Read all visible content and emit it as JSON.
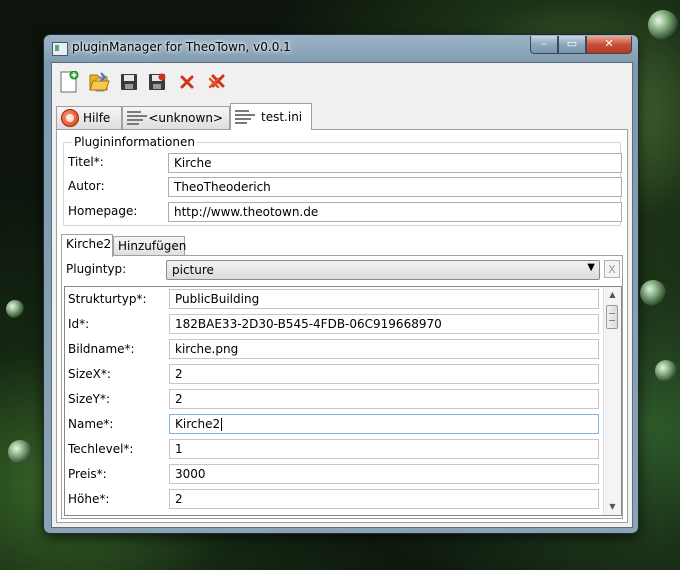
{
  "window": {
    "title": "pluginManager for TheoTown, v0.0.1",
    "min_glyph": "–",
    "max_glyph": "▭",
    "close_glyph": "✕"
  },
  "toolbar": {
    "icons": [
      "new-file-icon",
      "open-folder-icon",
      "save-icon",
      "save-as-icon",
      "delete-icon",
      "delete-all-icon"
    ]
  },
  "file_tabs": [
    {
      "label": "Hilfe",
      "icon": "help-icon"
    },
    {
      "label": "<unknown>",
      "icon": "document-icon"
    },
    {
      "label": "test.ini",
      "icon": "document-icon",
      "active": true
    }
  ],
  "plugin_info": {
    "group_title": "Plugininformationen",
    "fields": [
      {
        "label": "Titel*:",
        "value": "Kirche"
      },
      {
        "label": "Autor:",
        "value": "TheoTheoderich"
      },
      {
        "label": "Homepage:",
        "value": "http://www.theotown.de"
      }
    ]
  },
  "sub_tabs": [
    {
      "label": "Kirche2",
      "active": true
    },
    {
      "label": "Hinzufügen"
    }
  ],
  "plugintyp": {
    "label": "Plugintyp:",
    "value": "picture",
    "clear_label": "X"
  },
  "properties": [
    {
      "label": "Strukturtyp*:",
      "value": "PublicBuilding"
    },
    {
      "label": "Id*:",
      "value": "182BAE33-2D30-B545-4FDB-06C919668970"
    },
    {
      "label": "Bildname*:",
      "value": "kirche.png"
    },
    {
      "label": "SizeX*:",
      "value": "2"
    },
    {
      "label": "SizeY*:",
      "value": "2"
    },
    {
      "label": "Name*:",
      "value": "Kirche2"
    },
    {
      "label": "Techlevel*:",
      "value": "1"
    },
    {
      "label": "Preis*:",
      "value": "3000"
    },
    {
      "label": "Höhe*:",
      "value": "2"
    }
  ],
  "colors": {
    "accent_red": "#d0321a",
    "focus_blue": "#7eb4ea"
  }
}
